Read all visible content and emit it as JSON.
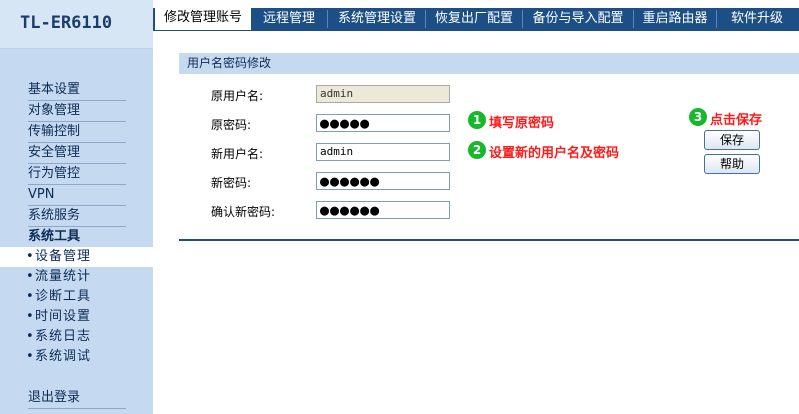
{
  "brand": "TL-ER6110",
  "sidebar": {
    "items": [
      {
        "label": "基本设置"
      },
      {
        "label": "对象管理"
      },
      {
        "label": "传输控制"
      },
      {
        "label": "安全管理"
      },
      {
        "label": "行为管控"
      },
      {
        "label": "VPN"
      },
      {
        "label": "系统服务"
      },
      {
        "label": "系统工具"
      }
    ],
    "subitems": [
      {
        "bullet": "•",
        "label": "设备管理"
      },
      {
        "bullet": "•",
        "label": "流量统计"
      },
      {
        "bullet": "•",
        "label": "诊断工具"
      },
      {
        "bullet": "•",
        "label": "时间设置"
      },
      {
        "bullet": "•",
        "label": "系统日志"
      },
      {
        "bullet": "•",
        "label": "系统调试"
      }
    ],
    "logout": "退出登录"
  },
  "tabs": [
    {
      "label": "修改管理账号"
    },
    {
      "label": "远程管理"
    },
    {
      "label": "系统管理设置"
    },
    {
      "label": "恢复出厂配置"
    },
    {
      "label": "备份与导入配置"
    },
    {
      "label": "重启路由器"
    },
    {
      "label": "软件升级"
    }
  ],
  "section": {
    "title": "用户名密码修改"
  },
  "form": {
    "orig_user_label": "原用户名:",
    "orig_user_value": "admin",
    "orig_pw_label": "原密码:",
    "orig_pw_value": "●●●●●",
    "new_user_label": "新用户名:",
    "new_user_value": "admin",
    "new_pw_label": "新密码:",
    "new_pw_value": "●●●●●●",
    "confirm_pw_label": "确认新密码:",
    "confirm_pw_value": "●●●●●●"
  },
  "annotations": [
    {
      "number": "1",
      "text": "填写原密码"
    },
    {
      "number": "2",
      "text": "设置新的用户名及密码"
    },
    {
      "number": "3",
      "text": "点击保存"
    }
  ],
  "buttons": {
    "save": "保存",
    "help": "帮助"
  },
  "colors": {
    "accent": "#1b4f86",
    "sidebar": "#c5daf0",
    "annotation": "#ff1a1a",
    "badge": "#17b82b"
  }
}
